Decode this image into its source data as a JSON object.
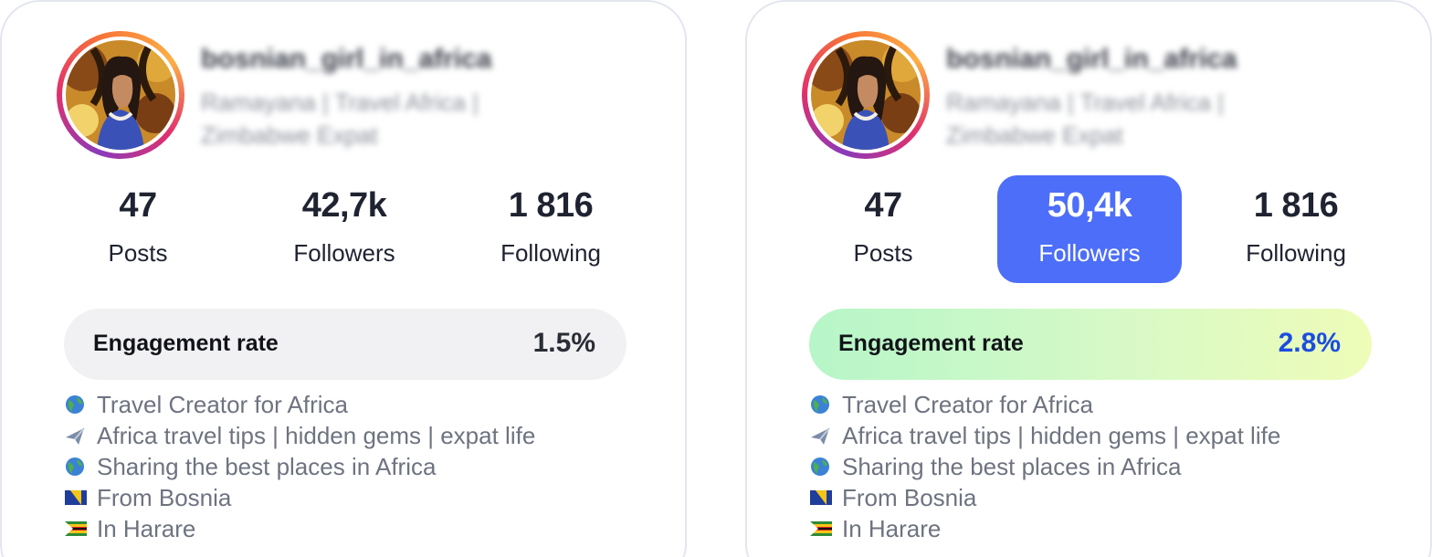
{
  "cards": [
    {
      "username": "bosnian_girl_in_africa",
      "bio_blurred": [
        "Ramayana | Travel Africa |",
        "Zimbabwe Expat"
      ],
      "stats": [
        {
          "value": "47",
          "label": "Posts"
        },
        {
          "value": "42,7k",
          "label": "Followers"
        },
        {
          "value": "1 816",
          "label": "Following"
        }
      ],
      "engagement": {
        "label": "Engagement rate",
        "value": "1.5%"
      },
      "bio_lines": [
        {
          "icon": "globe-icon",
          "text": "Travel Creator for Africa"
        },
        {
          "icon": "airplane-icon",
          "text": "Africa travel tips | hidden gems | expat life"
        },
        {
          "icon": "globe-icon",
          "text": "Sharing the best places in Africa"
        },
        {
          "icon": "bosnia-flag-icon",
          "text": "From Bosnia"
        },
        {
          "icon": "zimbabwe-flag-icon",
          "text": "In Harare"
        }
      ]
    },
    {
      "username": "bosnian_girl_in_africa",
      "bio_blurred": [
        "Ramayana | Travel Africa |",
        "Zimbabwe Expat"
      ],
      "stats": [
        {
          "value": "47",
          "label": "Posts"
        },
        {
          "value": "50,4k",
          "label": "Followers"
        },
        {
          "value": "1 816",
          "label": "Following"
        }
      ],
      "engagement": {
        "label": "Engagement rate",
        "value": "2.8%"
      },
      "bio_lines": [
        {
          "icon": "globe-icon",
          "text": "Travel Creator for Africa"
        },
        {
          "icon": "airplane-icon",
          "text": "Africa travel tips | hidden gems | expat life"
        },
        {
          "icon": "globe-icon",
          "text": "Sharing the best places in Africa"
        },
        {
          "icon": "bosnia-flag-icon",
          "text": "From Bosnia"
        },
        {
          "icon": "zimbabwe-flag-icon",
          "text": "In Harare"
        }
      ]
    }
  ],
  "colors": {
    "highlight": "#4d6ef8",
    "engagement_highlight_text": "#1b4de0",
    "card_border": "#e3e6ef"
  }
}
